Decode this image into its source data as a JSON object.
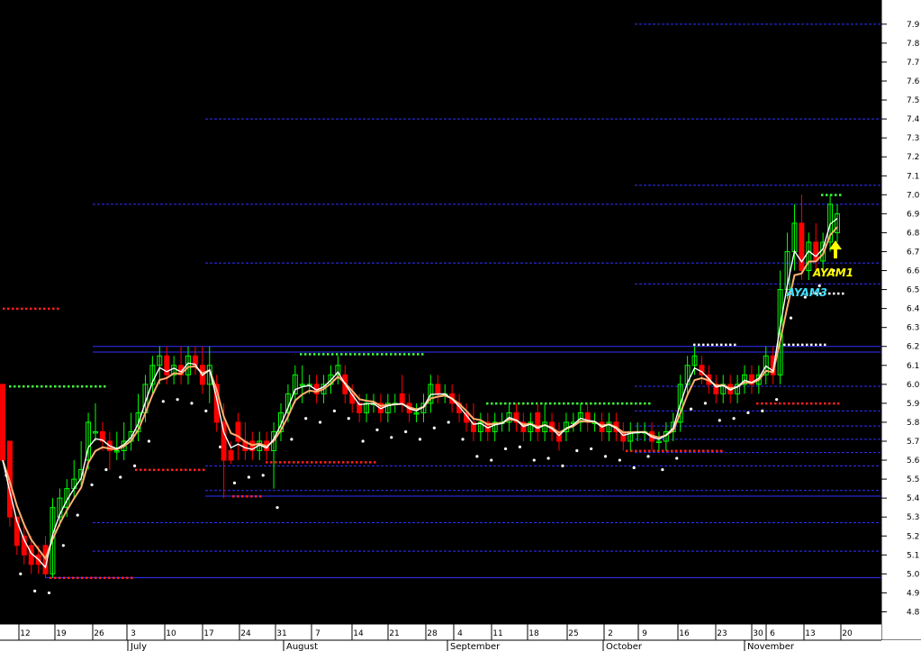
{
  "chart_data": {
    "type": "candlestick",
    "background": "#000000",
    "ylim": [
      4.75,
      7.98
    ],
    "y_ticks": [
      4.8,
      4.9,
      5.0,
      5.1,
      5.2,
      5.3,
      5.4,
      5.5,
      5.6,
      5.7,
      5.8,
      5.9,
      6.0,
      6.1,
      6.2,
      6.3,
      6.4,
      6.5,
      6.6,
      6.7,
      6.8,
      6.9,
      7.0,
      7.1,
      7.2,
      7.3,
      7.4,
      7.5,
      7.6,
      7.7,
      7.8,
      7.9
    ],
    "date_ticks": [
      "12",
      "19",
      "26",
      "3",
      "10",
      "17",
      "24",
      "31",
      "7",
      "14",
      "21",
      "28",
      "4",
      "11",
      "18",
      "25",
      "2",
      "9",
      "16",
      "23",
      "30",
      "6",
      "13",
      "20"
    ],
    "month_labels": [
      "July",
      "August",
      "September",
      "October",
      "November"
    ],
    "colors": {
      "up": "#00ff00",
      "down": "#ff0000",
      "white_line": "#ffffff",
      "orange_line": "#ffb070",
      "guide_blue": "#3030ff",
      "dot_red": "#ff2020",
      "dot_green": "#40ff40",
      "dot_white": "#ffffff",
      "annotation_yellow": "#ffff00",
      "annotation_cyan": "#40e0ff"
    },
    "annotations": [
      {
        "text": "AYAM1",
        "color": "#ffff00"
      },
      {
        "text": "AYAM3",
        "color": "#40e0ff"
      }
    ],
    "candles": [
      {
        "o": 6.0,
        "h": 6.0,
        "l": 5.6,
        "c": 5.6
      },
      {
        "o": 5.7,
        "h": 5.7,
        "l": 5.25,
        "c": 5.3
      },
      {
        "o": 5.3,
        "h": 5.3,
        "l": 5.1,
        "c": 5.15
      },
      {
        "o": 5.2,
        "h": 5.25,
        "l": 5.05,
        "c": 5.1
      },
      {
        "o": 5.15,
        "h": 5.2,
        "l": 5.0,
        "c": 5.05
      },
      {
        "o": 5.1,
        "h": 5.15,
        "l": 5.0,
        "c": 5.05
      },
      {
        "o": 5.15,
        "h": 5.2,
        "l": 4.98,
        "c": 5.0
      },
      {
        "o": 5.0,
        "h": 5.4,
        "l": 4.98,
        "c": 5.35
      },
      {
        "o": 5.3,
        "h": 5.45,
        "l": 5.25,
        "c": 5.4
      },
      {
        "o": 5.35,
        "h": 5.5,
        "l": 5.3,
        "c": 5.45
      },
      {
        "o": 5.45,
        "h": 5.6,
        "l": 5.4,
        "c": 5.5
      },
      {
        "o": 5.5,
        "h": 5.7,
        "l": 5.45,
        "c": 5.55
      },
      {
        "o": 5.6,
        "h": 5.85,
        "l": 5.55,
        "c": 5.8
      },
      {
        "o": 5.75,
        "h": 5.9,
        "l": 5.7,
        "c": 5.75
      },
      {
        "o": 5.75,
        "h": 5.8,
        "l": 5.65,
        "c": 5.7
      },
      {
        "o": 5.7,
        "h": 5.75,
        "l": 5.55,
        "c": 5.65
      },
      {
        "o": 5.65,
        "h": 5.75,
        "l": 5.6,
        "c": 5.65
      },
      {
        "o": 5.65,
        "h": 5.8,
        "l": 5.6,
        "c": 5.7
      },
      {
        "o": 5.7,
        "h": 5.85,
        "l": 5.65,
        "c": 5.75
      },
      {
        "o": 5.75,
        "h": 5.95,
        "l": 5.7,
        "c": 5.85
      },
      {
        "o": 5.85,
        "h": 6.05,
        "l": 5.8,
        "c": 6.0
      },
      {
        "o": 6.0,
        "h": 6.15,
        "l": 5.95,
        "c": 6.1
      },
      {
        "o": 6.1,
        "h": 6.2,
        "l": 6.0,
        "c": 6.15
      },
      {
        "o": 6.15,
        "h": 6.2,
        "l": 6.0,
        "c": 6.05
      },
      {
        "o": 6.05,
        "h": 6.15,
        "l": 6.0,
        "c": 6.1
      },
      {
        "o": 6.1,
        "h": 6.2,
        "l": 6.0,
        "c": 6.05
      },
      {
        "o": 6.05,
        "h": 6.2,
        "l": 6.0,
        "c": 6.15
      },
      {
        "o": 6.15,
        "h": 6.2,
        "l": 6.05,
        "c": 6.1
      },
      {
        "o": 6.1,
        "h": 6.2,
        "l": 5.95,
        "c": 6.0
      },
      {
        "o": 6.0,
        "h": 6.2,
        "l": 5.9,
        "c": 6.1
      },
      {
        "o": 6.0,
        "h": 6.05,
        "l": 5.75,
        "c": 5.8
      },
      {
        "o": 5.8,
        "h": 5.9,
        "l": 5.4,
        "c": 5.6
      },
      {
        "o": 5.65,
        "h": 5.7,
        "l": 5.58,
        "c": 5.6
      },
      {
        "o": 5.8,
        "h": 5.85,
        "l": 5.6,
        "c": 5.7
      },
      {
        "o": 5.7,
        "h": 5.8,
        "l": 5.6,
        "c": 5.65
      },
      {
        "o": 5.7,
        "h": 5.75,
        "l": 5.6,
        "c": 5.65
      },
      {
        "o": 5.65,
        "h": 5.75,
        "l": 5.6,
        "c": 5.7
      },
      {
        "o": 5.7,
        "h": 5.75,
        "l": 5.6,
        "c": 5.65
      },
      {
        "o": 5.65,
        "h": 5.8,
        "l": 5.45,
        "c": 5.75
      },
      {
        "o": 5.75,
        "h": 5.9,
        "l": 5.7,
        "c": 5.85
      },
      {
        "o": 5.85,
        "h": 6.0,
        "l": 5.8,
        "c": 5.95
      },
      {
        "o": 5.95,
        "h": 6.1,
        "l": 5.9,
        "c": 6.05
      },
      {
        "o": 6.0,
        "h": 6.1,
        "l": 5.9,
        "c": 6.0
      },
      {
        "o": 6.0,
        "h": 6.05,
        "l": 5.95,
        "c": 6.0
      },
      {
        "o": 6.0,
        "h": 6.05,
        "l": 5.9,
        "c": 5.95
      },
      {
        "o": 5.95,
        "h": 6.05,
        "l": 5.9,
        "c": 6.0
      },
      {
        "o": 6.0,
        "h": 6.1,
        "l": 5.95,
        "c": 6.05
      },
      {
        "o": 6.05,
        "h": 6.15,
        "l": 6.0,
        "c": 6.1
      },
      {
        "o": 6.05,
        "h": 6.1,
        "l": 5.9,
        "c": 5.95
      },
      {
        "o": 5.95,
        "h": 6.0,
        "l": 5.85,
        "c": 5.9
      },
      {
        "o": 5.9,
        "h": 5.95,
        "l": 5.8,
        "c": 5.85
      },
      {
        "o": 5.85,
        "h": 5.95,
        "l": 5.8,
        "c": 5.9
      },
      {
        "o": 5.9,
        "h": 5.95,
        "l": 5.85,
        "c": 5.9
      },
      {
        "o": 5.9,
        "h": 5.95,
        "l": 5.8,
        "c": 5.85
      },
      {
        "o": 5.85,
        "h": 5.95,
        "l": 5.8,
        "c": 5.9
      },
      {
        "o": 5.9,
        "h": 5.95,
        "l": 5.85,
        "c": 5.9
      },
      {
        "o": 5.95,
        "h": 6.05,
        "l": 5.85,
        "c": 5.9
      },
      {
        "o": 5.9,
        "h": 5.95,
        "l": 5.8,
        "c": 5.85
      },
      {
        "o": 5.85,
        "h": 5.9,
        "l": 5.8,
        "c": 5.85
      },
      {
        "o": 5.85,
        "h": 5.95,
        "l": 5.8,
        "c": 5.9
      },
      {
        "o": 5.9,
        "h": 6.05,
        "l": 5.85,
        "c": 6.0
      },
      {
        "o": 6.0,
        "h": 6.05,
        "l": 5.9,
        "c": 5.95
      },
      {
        "o": 5.95,
        "h": 6.0,
        "l": 5.9,
        "c": 5.95
      },
      {
        "o": 5.95,
        "h": 6.0,
        "l": 5.85,
        "c": 5.9
      },
      {
        "o": 5.9,
        "h": 5.95,
        "l": 5.8,
        "c": 5.85
      },
      {
        "o": 5.85,
        "h": 5.9,
        "l": 5.75,
        "c": 5.8
      },
      {
        "o": 5.8,
        "h": 5.9,
        "l": 5.7,
        "c": 5.75
      },
      {
        "o": 5.75,
        "h": 5.85,
        "l": 5.7,
        "c": 5.8
      },
      {
        "o": 5.8,
        "h": 5.85,
        "l": 5.7,
        "c": 5.75
      },
      {
        "o": 5.75,
        "h": 5.85,
        "l": 5.7,
        "c": 5.8
      },
      {
        "o": 5.8,
        "h": 5.85,
        "l": 5.75,
        "c": 5.8
      },
      {
        "o": 5.8,
        "h": 5.9,
        "l": 5.75,
        "c": 5.85
      },
      {
        "o": 5.85,
        "h": 5.9,
        "l": 5.75,
        "c": 5.8
      },
      {
        "o": 5.8,
        "h": 5.85,
        "l": 5.7,
        "c": 5.75
      },
      {
        "o": 5.75,
        "h": 5.85,
        "l": 5.7,
        "c": 5.8
      },
      {
        "o": 5.85,
        "h": 5.9,
        "l": 5.7,
        "c": 5.75
      },
      {
        "o": 5.75,
        "h": 5.9,
        "l": 5.7,
        "c": 5.8
      },
      {
        "o": 5.8,
        "h": 5.85,
        "l": 5.7,
        "c": 5.75
      },
      {
        "o": 5.75,
        "h": 5.8,
        "l": 5.65,
        "c": 5.7
      },
      {
        "o": 5.75,
        "h": 5.85,
        "l": 5.7,
        "c": 5.8
      },
      {
        "o": 5.8,
        "h": 5.85,
        "l": 5.75,
        "c": 5.8
      },
      {
        "o": 5.8,
        "h": 5.9,
        "l": 5.75,
        "c": 5.85
      },
      {
        "o": 5.85,
        "h": 5.9,
        "l": 5.75,
        "c": 5.8
      },
      {
        "o": 5.8,
        "h": 5.85,
        "l": 5.75,
        "c": 5.8
      },
      {
        "o": 5.8,
        "h": 5.85,
        "l": 5.7,
        "c": 5.75
      },
      {
        "o": 5.75,
        "h": 5.85,
        "l": 5.7,
        "c": 5.8
      },
      {
        "o": 5.8,
        "h": 5.85,
        "l": 5.7,
        "c": 5.75
      },
      {
        "o": 5.75,
        "h": 5.8,
        "l": 5.65,
        "c": 5.7
      },
      {
        "o": 5.7,
        "h": 5.8,
        "l": 5.65,
        "c": 5.75
      },
      {
        "o": 5.75,
        "h": 5.8,
        "l": 5.7,
        "c": 5.75
      },
      {
        "o": 5.75,
        "h": 5.8,
        "l": 5.7,
        "c": 5.75
      },
      {
        "o": 5.75,
        "h": 5.8,
        "l": 5.65,
        "c": 5.7
      },
      {
        "o": 5.7,
        "h": 5.75,
        "l": 5.65,
        "c": 5.7
      },
      {
        "o": 5.7,
        "h": 5.8,
        "l": 5.65,
        "c": 5.75
      },
      {
        "o": 5.75,
        "h": 5.85,
        "l": 5.7,
        "c": 5.8
      },
      {
        "o": 5.8,
        "h": 6.05,
        "l": 5.75,
        "c": 6.0
      },
      {
        "o": 6.0,
        "h": 6.15,
        "l": 5.95,
        "c": 6.1
      },
      {
        "o": 6.1,
        "h": 6.2,
        "l": 6.05,
        "c": 6.15
      },
      {
        "o": 6.1,
        "h": 6.15,
        "l": 6.0,
        "c": 6.05
      },
      {
        "o": 6.05,
        "h": 6.1,
        "l": 5.95,
        "c": 6.0
      },
      {
        "o": 6.0,
        "h": 6.05,
        "l": 5.9,
        "c": 5.95
      },
      {
        "o": 5.95,
        "h": 6.05,
        "l": 5.9,
        "c": 6.0
      },
      {
        "o": 6.0,
        "h": 6.05,
        "l": 5.9,
        "c": 5.95
      },
      {
        "o": 5.95,
        "h": 6.05,
        "l": 5.9,
        "c": 6.0
      },
      {
        "o": 6.0,
        "h": 6.1,
        "l": 5.95,
        "c": 6.05
      },
      {
        "o": 6.05,
        "h": 6.1,
        "l": 5.95,
        "c": 6.0
      },
      {
        "o": 6.0,
        "h": 6.1,
        "l": 5.95,
        "c": 6.05
      },
      {
        "o": 6.05,
        "h": 6.2,
        "l": 6.0,
        "c": 6.15
      },
      {
        "o": 6.15,
        "h": 6.2,
        "l": 6.0,
        "c": 6.05
      },
      {
        "o": 6.05,
        "h": 6.6,
        "l": 6.0,
        "c": 6.5
      },
      {
        "o": 6.5,
        "h": 6.8,
        "l": 6.45,
        "c": 6.7
      },
      {
        "o": 6.7,
        "h": 6.95,
        "l": 6.6,
        "c": 6.85
      },
      {
        "o": 6.85,
        "h": 7.0,
        "l": 6.55,
        "c": 6.6
      },
      {
        "o": 6.6,
        "h": 6.8,
        "l": 6.55,
        "c": 6.75
      },
      {
        "o": 6.75,
        "h": 6.85,
        "l": 6.6,
        "c": 6.65
      },
      {
        "o": 6.65,
        "h": 6.8,
        "l": 6.6,
        "c": 6.75
      },
      {
        "o": 6.75,
        "h": 7.0,
        "l": 6.7,
        "c": 6.95
      },
      {
        "o": 6.8,
        "h": 6.95,
        "l": 6.75,
        "c": 6.9
      }
    ]
  }
}
